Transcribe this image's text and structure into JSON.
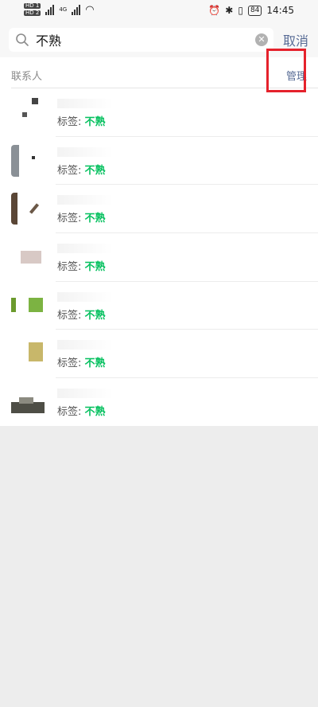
{
  "status_bar": {
    "time": "14:45",
    "battery": "84",
    "hd1": "HD 1",
    "hd2": "HD 2",
    "net": "4G"
  },
  "search": {
    "query": "不熟",
    "cancel_label": "取消"
  },
  "section": {
    "title": "联系人",
    "manage_label": "管理"
  },
  "contacts": [
    {
      "tag_label": "标签:",
      "tag_value": "不熟"
    },
    {
      "tag_label": "标签:",
      "tag_value": "不熟"
    },
    {
      "tag_label": "标签:",
      "tag_value": "不熟"
    },
    {
      "tag_label": "标签:",
      "tag_value": "不熟"
    },
    {
      "tag_label": "标签:",
      "tag_value": "不熟"
    },
    {
      "tag_label": "标签:",
      "tag_value": "不熟"
    },
    {
      "tag_label": "标签:",
      "tag_value": "不熟"
    }
  ],
  "colors": {
    "accent_green": "#07c160",
    "link_blue": "#576b95",
    "highlight_red": "#e5222c"
  }
}
